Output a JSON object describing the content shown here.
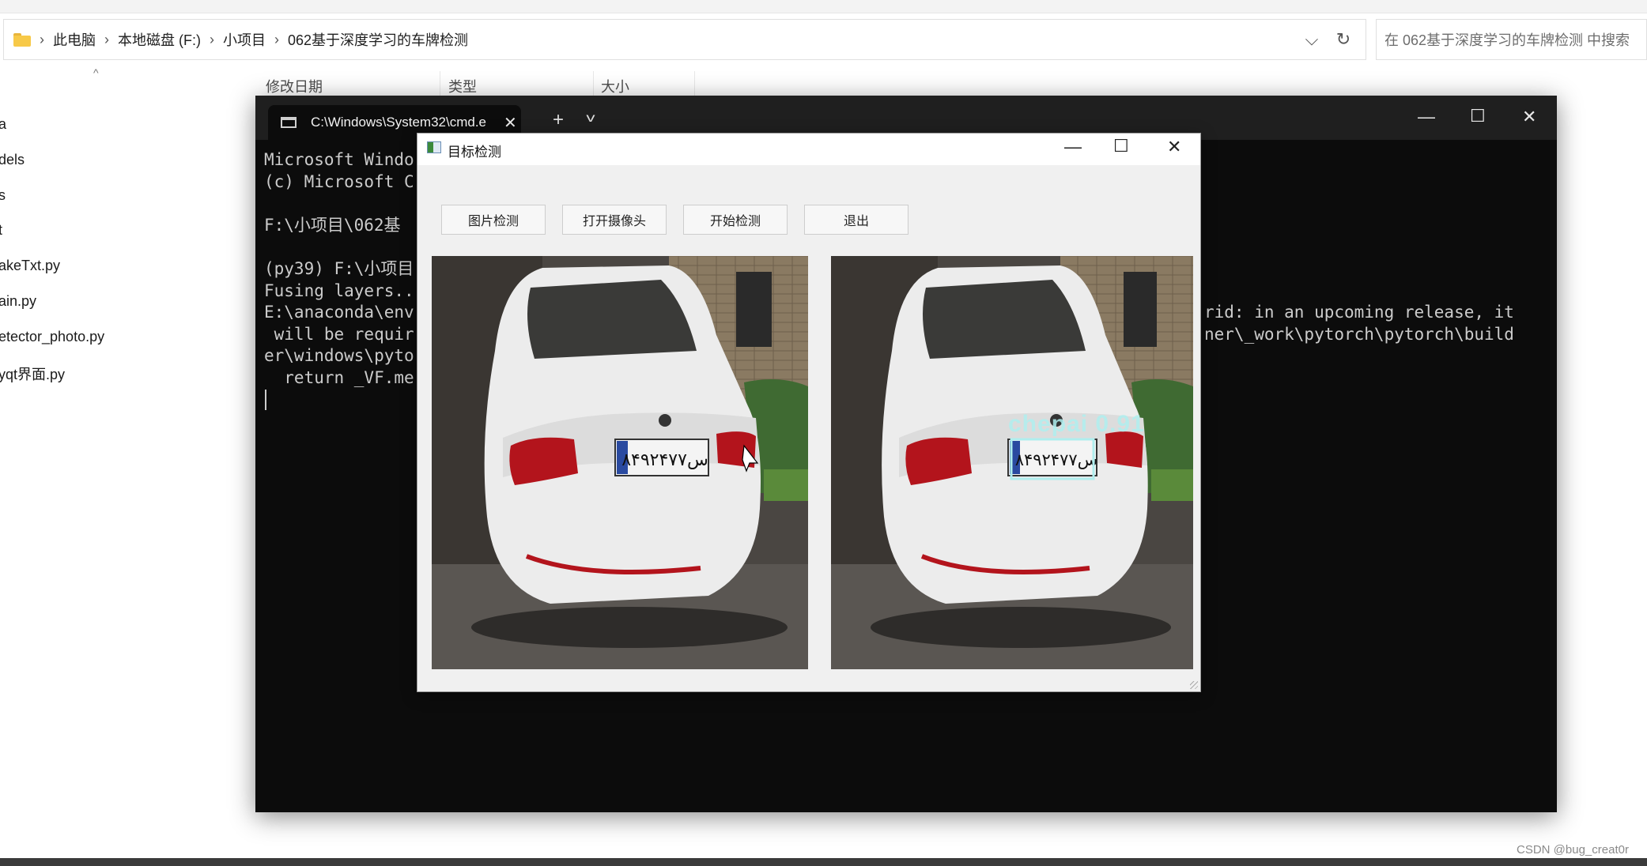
{
  "explorer": {
    "breadcrumbs": [
      "此电脑",
      "本地磁盘 (F:)",
      "小项目",
      "062基于深度学习的车牌检测"
    ],
    "search_placeholder": "在 062基于深度学习的车牌检测 中搜索",
    "columns": [
      "修改日期",
      "类型",
      "大小"
    ],
    "sidebar_files": [
      "a",
      "dels",
      "s",
      "t",
      "akeTxt.py",
      "ain.py",
      "etector_photo.py",
      "yqt界面.py"
    ]
  },
  "terminal": {
    "tab_title": "C:\\Windows\\System32\\cmd.e",
    "lines": [
      "Microsoft Windo",
      "(c) Microsoft C",
      "",
      "F:\\小项目\\062基",
      "",
      "(py39) F:\\小项目",
      "Fusing layers..",
      "E:\\anaconda\\env",
      " will be requir",
      "er\\windows\\pyto",
      "  return _VF.me"
    ],
    "right_lines": [
      "rid: in an upcoming release, it",
      "ner\\_work\\pytorch\\pytorch\\build"
    ]
  },
  "dialog": {
    "title": "目标检测",
    "buttons": {
      "image_detect": "图片检测",
      "open_camera": "打开摄像头",
      "start_detect": "开始检测",
      "exit": "退出"
    },
    "detection_label": "chepai 0.91",
    "plate_text": "۸۴س۹۲۴۷۷"
  },
  "watermark": "CSDN @bug_creat0r",
  "colors": {
    "terminal_bg": "#0c0c0c",
    "terminal_text": "#cccccc",
    "dialog_bg": "#f0f0f0",
    "detection_box": "#afeeee"
  }
}
